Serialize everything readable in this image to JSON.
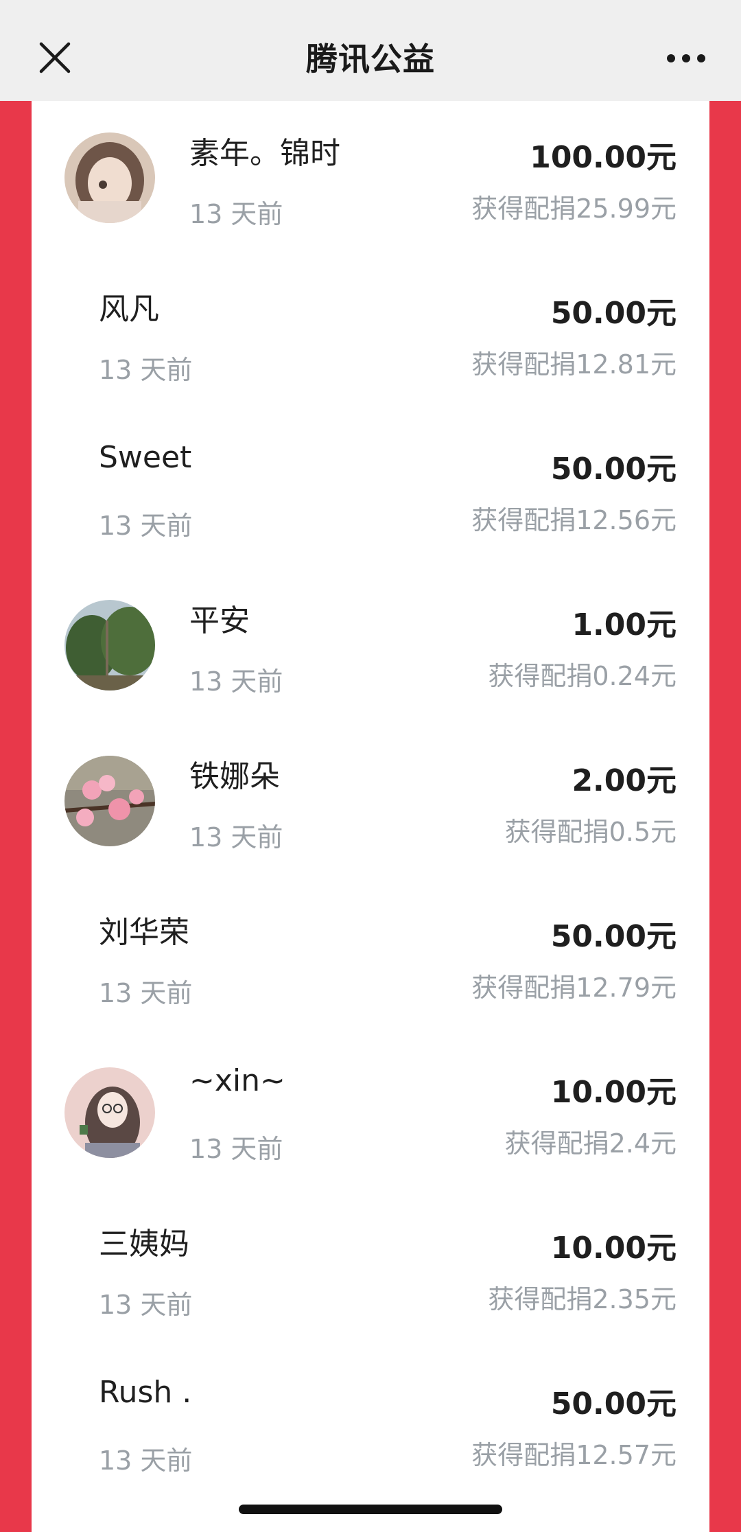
{
  "header": {
    "title": "腾讯公益"
  },
  "donations": [
    {
      "name": "素年。锦时",
      "time": "13 天前",
      "amount": "100.00元",
      "match": "获得配捐25.99元",
      "avatar": "girl-portrait"
    },
    {
      "name": "风凡",
      "time": "13 天前",
      "amount": "50.00元",
      "match": "获得配捐12.81元"
    },
    {
      "name": "Sweet",
      "time": "13 天前",
      "amount": "50.00元",
      "match": "获得配捐12.56元"
    },
    {
      "name": "平安",
      "time": "13 天前",
      "amount": "1.00元",
      "match": "获得配捐0.24元",
      "avatar": "trees-photo"
    },
    {
      "name": "铁娜朵",
      "time": "13 天前",
      "amount": "2.00元",
      "match": "获得配捐0.5元",
      "avatar": "peach-blossom-photo"
    },
    {
      "name": "刘华荣",
      "time": "13 天前",
      "amount": "50.00元",
      "match": "获得配捐12.79元"
    },
    {
      "name": "~xin~",
      "time": "13 天前",
      "amount": "10.00元",
      "match": "获得配捐2.4元",
      "avatar": "illustrated-girl"
    },
    {
      "name": "三姨妈",
      "time": "13 天前",
      "amount": "10.00元",
      "match": "获得配捐2.35元"
    },
    {
      "name": "Rush .",
      "time": "13 天前",
      "amount": "50.00元",
      "match": "获得配捐12.57元"
    }
  ],
  "colors": {
    "accent": "#e8384a",
    "header_bg": "#efefef",
    "text_primary": "#1f1f1f",
    "text_secondary": "#9aa0a6"
  }
}
